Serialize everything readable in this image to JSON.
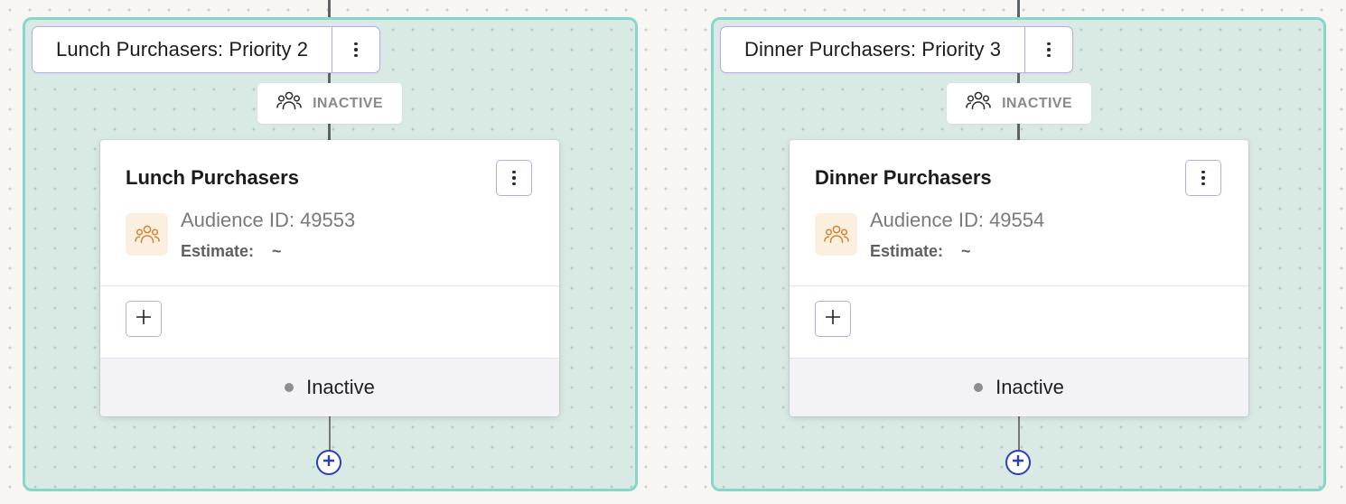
{
  "groups": [
    {
      "title": "Lunch Purchasers: Priority 2",
      "status_pill": "INACTIVE",
      "card": {
        "name": "Lunch Purchasers",
        "audience_id": "Audience ID: 49553",
        "estimate_label": "Estimate:",
        "estimate_value": "~",
        "status": "Inactive"
      }
    },
    {
      "title": "Dinner Purchasers: Priority 3",
      "status_pill": "INACTIVE",
      "card": {
        "name": "Dinner Purchasers",
        "audience_id": "Audience ID: 49554",
        "estimate_label": "Estimate:",
        "estimate_value": "~",
        "status": "Inactive"
      }
    }
  ],
  "icons": {
    "group_menu": "kebab-icon",
    "pill_icon": "people-group-icon",
    "audience_icon": "people-group-icon",
    "card_menu": "kebab-icon",
    "add": "plus-icon",
    "add_node": "plus-circle-icon"
  },
  "colors": {
    "group_border": "#86d6cc",
    "group_fill": "#d9e9e4",
    "accent_border": "#b9a9ee",
    "audience_icon_bg": "#fbefdf",
    "audience_icon_stroke": "#d4822e",
    "add_node": "#2941b8",
    "status_dot": "#8e8e8e"
  }
}
